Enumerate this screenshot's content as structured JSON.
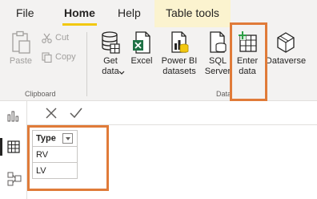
{
  "tabs": {
    "file": "File",
    "home": "Home",
    "help": "Help",
    "table_tools": "Table tools"
  },
  "clipboard": {
    "paste": "Paste",
    "cut": "Cut",
    "copy": "Copy",
    "group_label": "Clipboard"
  },
  "data_group": {
    "get_data": "Get data",
    "excel": "Excel",
    "power_bi": "Power BI datasets",
    "sql_server": "SQL Server",
    "enter_data": "Enter data",
    "dataverse": "Dataverse",
    "group_label": "Data"
  },
  "table": {
    "header": "Type",
    "rows": [
      "RV",
      "LV"
    ]
  },
  "colors": {
    "accent_underline": "#f2c811",
    "highlight_box": "#e07b39",
    "excel_green": "#1e7145",
    "enter_data_plus": "#2e9e45"
  }
}
